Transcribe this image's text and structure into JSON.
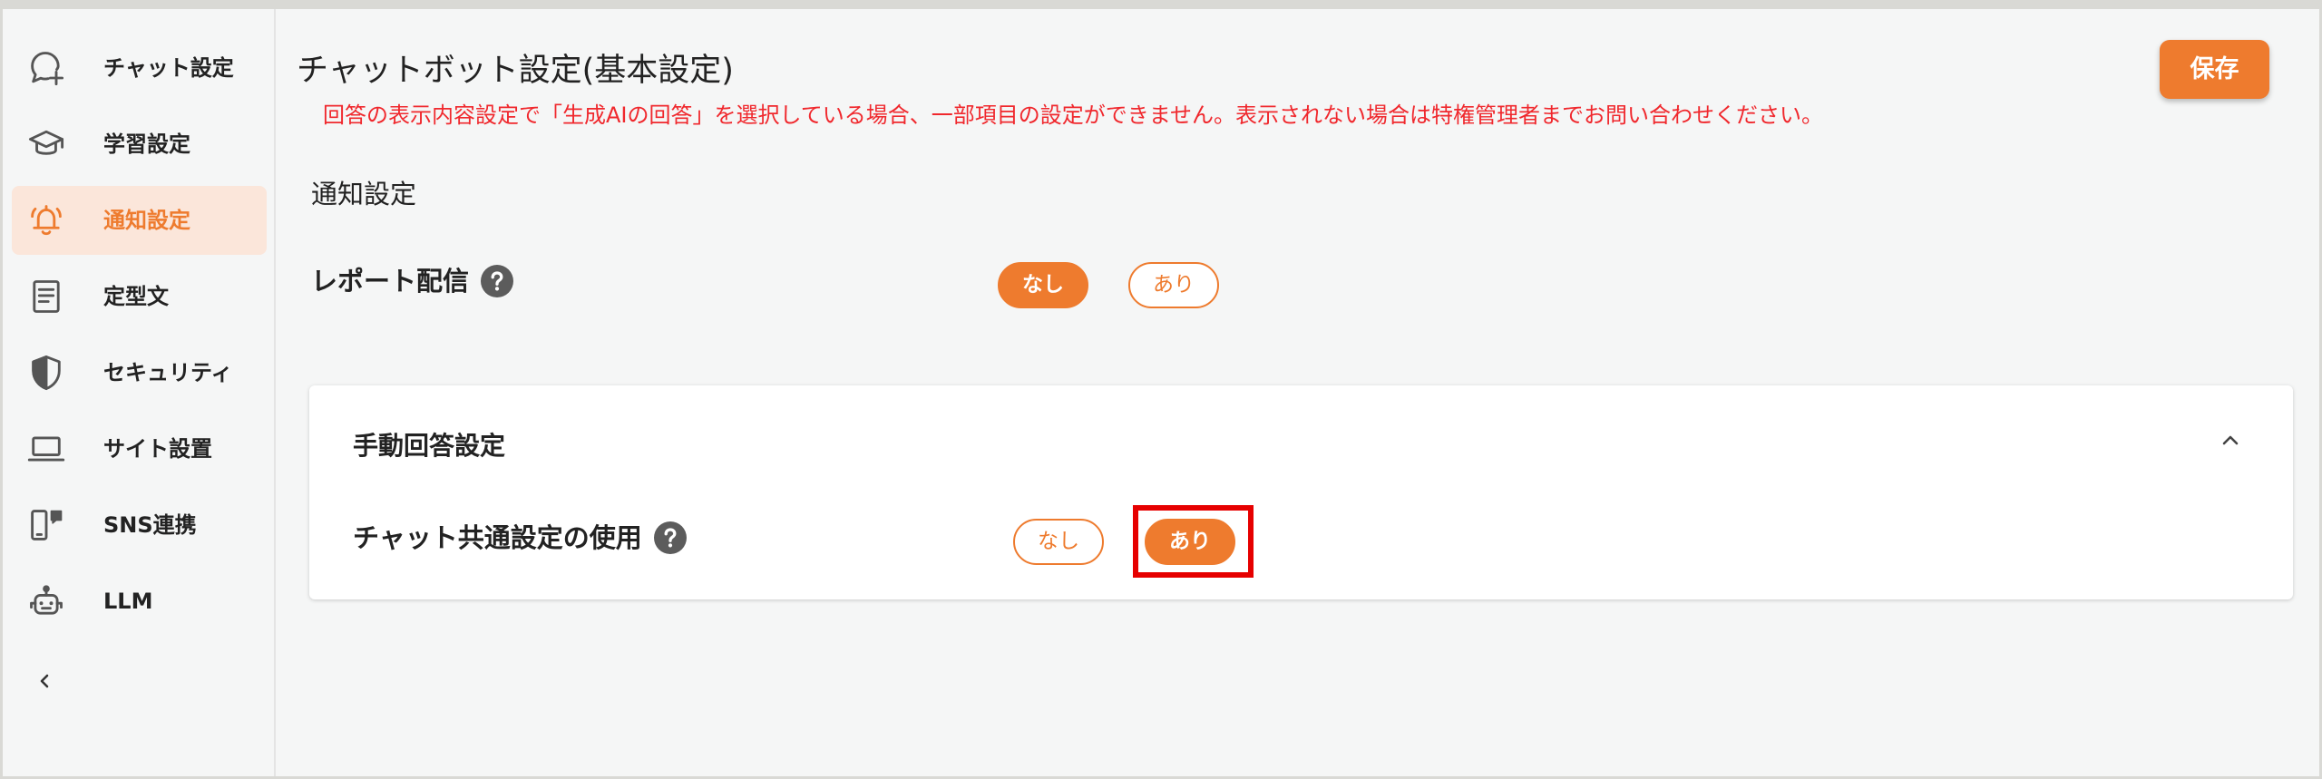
{
  "theme": {
    "accent": "#EE7B2E",
    "active_background": "#FBE6DA",
    "notice_red": "#F0282D",
    "highlight_red": "#E60000",
    "background": "#F5F6F6"
  },
  "sidebar": {
    "items": [
      {
        "label": "チャット設定",
        "icon": "chat-add-icon",
        "active": false
      },
      {
        "label": "学習設定",
        "icon": "graduation-cap-icon",
        "active": false
      },
      {
        "label": "通知設定",
        "icon": "bell-icon",
        "active": true
      },
      {
        "label": "定型文",
        "icon": "document-icon",
        "active": false
      },
      {
        "label": "セキュリティ",
        "icon": "shield-icon",
        "active": false
      },
      {
        "label": "サイト設置",
        "icon": "laptop-icon",
        "active": false
      },
      {
        "label": "SNS連携",
        "icon": "phone-chat-icon",
        "active": false
      },
      {
        "label": "LLM",
        "icon": "robot-icon",
        "active": false
      }
    ],
    "collapse_icon": "chevron-left-icon"
  },
  "header": {
    "title": "チャットボット設定(基本設定)",
    "notice": "回答の表示内容設定で「生成AIの回答」を選択している場合、一部項目の設定ができません。表示されない場合は特権管理者までお問い合わせください。",
    "save_label": "保存"
  },
  "notification": {
    "heading": "通知設定",
    "report_delivery": {
      "label": "レポート配信",
      "help_icon": "help-icon",
      "options": [
        {
          "label": "なし",
          "selected": true
        },
        {
          "label": "あり",
          "selected": false
        }
      ]
    }
  },
  "manual_reply": {
    "title": "手動回答設定",
    "expanded": true,
    "toggle_icon": "chevron-up-icon",
    "chat_common": {
      "label": "チャット共通設定の使用",
      "help_icon": "help-icon",
      "highlighted": true,
      "options": [
        {
          "label": "なし",
          "selected": false
        },
        {
          "label": "あり",
          "selected": true
        }
      ]
    }
  }
}
